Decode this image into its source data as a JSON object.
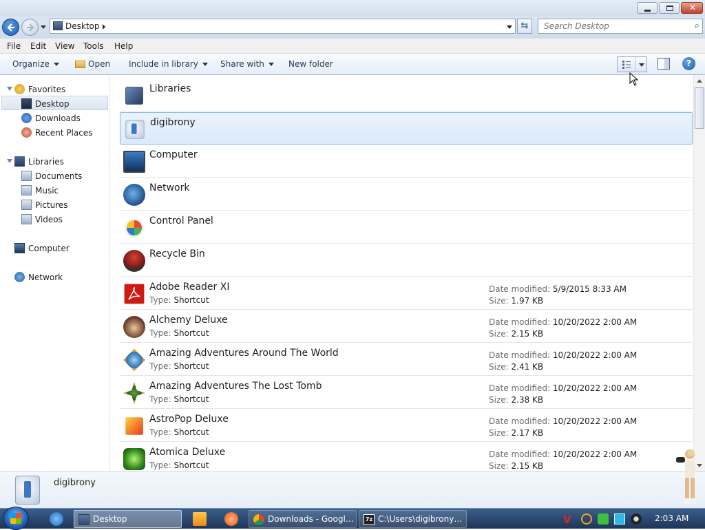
{
  "address": {
    "crumb": "Desktop"
  },
  "search": {
    "placeholder": "Search Desktop"
  },
  "menu": [
    "File",
    "Edit",
    "View",
    "Tools",
    "Help"
  ],
  "commands": {
    "organize": "Organize",
    "open": "Open",
    "include": "Include in library",
    "share": "Share with",
    "new_folder": "New folder"
  },
  "nav": {
    "favorites": "Favorites",
    "desktop": "Desktop",
    "downloads": "Downloads",
    "recent": "Recent Places",
    "libraries": "Libraries",
    "documents": "Documents",
    "music": "Music",
    "pictures": "Pictures",
    "videos": "Videos",
    "computer": "Computer",
    "network": "Network"
  },
  "labels": {
    "date": "Date modified:",
    "size": "Size:",
    "type": "Type:"
  },
  "items": [
    {
      "name": "Libraries"
    },
    {
      "name": "digibrony"
    },
    {
      "name": "Computer"
    },
    {
      "name": "Network"
    },
    {
      "name": "Control Panel"
    },
    {
      "name": "Recycle Bin"
    },
    {
      "name": "Adobe Reader XI",
      "type": "Shortcut",
      "date": "5/9/2015 8:33 AM",
      "size": "1.97 KB"
    },
    {
      "name": "Alchemy Deluxe",
      "type": "Shortcut",
      "date": "10/20/2022 2:00 AM",
      "size": "2.15 KB"
    },
    {
      "name": "Amazing Adventures Around The World",
      "type": "Shortcut",
      "date": "10/20/2022 2:00 AM",
      "size": "2.41 KB"
    },
    {
      "name": "Amazing Adventures The Lost Tomb",
      "type": "Shortcut",
      "date": "10/20/2022 2:00 AM",
      "size": "2.38 KB"
    },
    {
      "name": "AstroPop Deluxe",
      "type": "Shortcut",
      "date": "10/20/2022 2:00 AM",
      "size": "2.17 KB"
    },
    {
      "name": "Atomica Deluxe",
      "type": "Shortcut",
      "date": "10/20/2022 2:00 AM",
      "size": "2.15 KB"
    }
  ],
  "details": {
    "name": "digibrony"
  },
  "taskbar": {
    "desktop": "Desktop",
    "chrome": "Downloads - Google ...",
    "sevenzip": "C:\\Users\\digibrony\\..."
  },
  "clock": "2:03 AM"
}
